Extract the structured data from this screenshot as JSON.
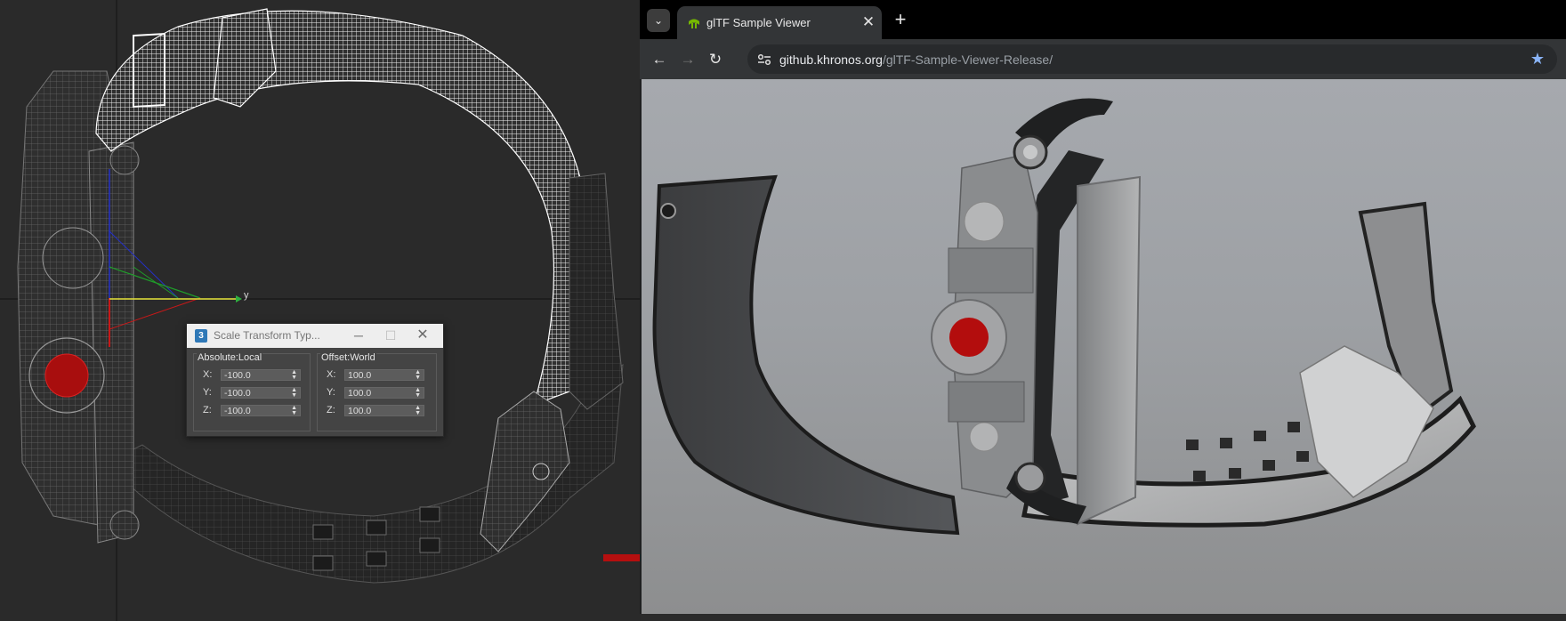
{
  "viewport": {
    "axis_label_y": "y"
  },
  "dialog": {
    "title": "Scale Transform Typ...",
    "app_icon_text": "3",
    "minimize": "─",
    "maximize": "☐",
    "close": "✕",
    "absolute": {
      "label": "Absolute:Local",
      "x_label": "X:",
      "x_value": "-100.0",
      "y_label": "Y:",
      "y_value": "-100.0",
      "z_label": "Z:",
      "z_value": "-100.0"
    },
    "offset": {
      "label": "Offset:World",
      "x_label": "X:",
      "x_value": "100.0",
      "y_label": "Y:",
      "y_value": "100.0",
      "z_label": "Z:",
      "z_value": "100.0"
    }
  },
  "browser": {
    "tab_menu_icon": "⌄",
    "tab_title": "glTF Sample Viewer",
    "tab_close": "✕",
    "new_tab": "+",
    "back": "←",
    "forward": "→",
    "reload": "↻",
    "url_host": "github.khronos.org",
    "url_path": "/glTF-Sample-Viewer-Release/",
    "bookmark_icon": "★"
  },
  "colors": {
    "accent_red": "#b50f0f",
    "bookmark_blue": "#8ab4f8",
    "favicon_green": "#76b900"
  }
}
